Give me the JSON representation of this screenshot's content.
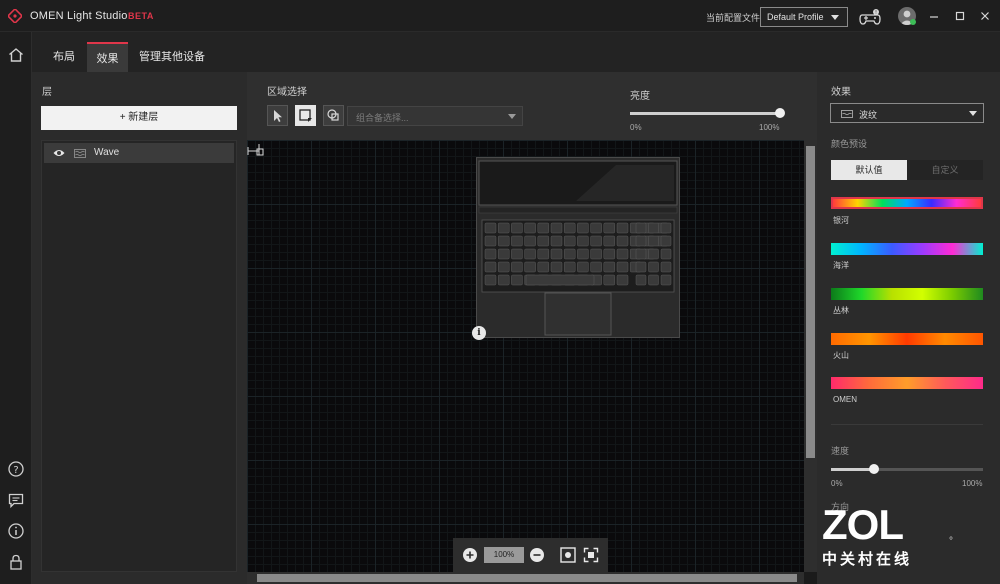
{
  "titlebar": {
    "app_title": "OMEN Light Studio",
    "beta_badge": "BETA",
    "profile_label": "当前配置文件",
    "profile_value": "Default Profile"
  },
  "tabs": [
    {
      "label": "布局",
      "active": false
    },
    {
      "label": "效果",
      "active": true
    },
    {
      "label": "管理其他设备",
      "active": false
    }
  ],
  "layers": {
    "title": "层",
    "new_layer_button": "+ 新建层",
    "items": [
      {
        "label": "Wave",
        "icon": "wave-icon",
        "visible": true
      }
    ]
  },
  "canvas_head": {
    "zone_select_label": "区域选择",
    "zone_combo_placeholder": "组合备选择...",
    "brightness_label": "亮度",
    "brightness_min": "0%",
    "brightness_max": "100%",
    "brightness_value": 1.0
  },
  "zoom": {
    "value": "100%"
  },
  "effects": {
    "title": "效果",
    "effect_value": "波纹",
    "color_label": "颜色预设",
    "seg_default": "默认值",
    "seg_custom": "自定义",
    "presets": [
      {
        "label": "银河",
        "gradient": [
          "#ff3b3b",
          "#ffd400",
          "#00e05a",
          "#00a8ff",
          "#3a2bff",
          "#ff2bd4",
          "#ff3b3b"
        ],
        "selected": true
      },
      {
        "label": "海洋",
        "gradient": [
          "#00f0d0",
          "#00b4ff",
          "#3a5bff",
          "#9b3bff",
          "#ff2bd4",
          "#00f0d0"
        ],
        "selected": false
      },
      {
        "label": "丛林",
        "gradient": [
          "#0c7a1a",
          "#1fd82a",
          "#b8e000",
          "#d2ff00",
          "#7acb00",
          "#1f8a1f"
        ],
        "selected": false
      },
      {
        "label": "火山",
        "gradient": [
          "#ff6a00",
          "#ff9500",
          "#ff3b00",
          "#ff8a00",
          "#ff5500"
        ],
        "selected": false
      },
      {
        "label": "OMEN",
        "gradient": [
          "#ff2a6b",
          "#ff6b3b",
          "#ff9d2a",
          "#ff5a5a",
          "#ff2a8a"
        ],
        "selected": false
      }
    ],
    "speed_label": "速度",
    "speed_min": "0%",
    "speed_max": "100%",
    "speed_value": 0.28,
    "partial_label": "方向",
    "partial_value": "°"
  },
  "watermark": {
    "brand": "ZOL",
    "subtitle": "中关村在线"
  },
  "colors": {
    "accent": "#e0364a",
    "panel": "#2b2b2b",
    "canvas": "#0a0a0c"
  }
}
